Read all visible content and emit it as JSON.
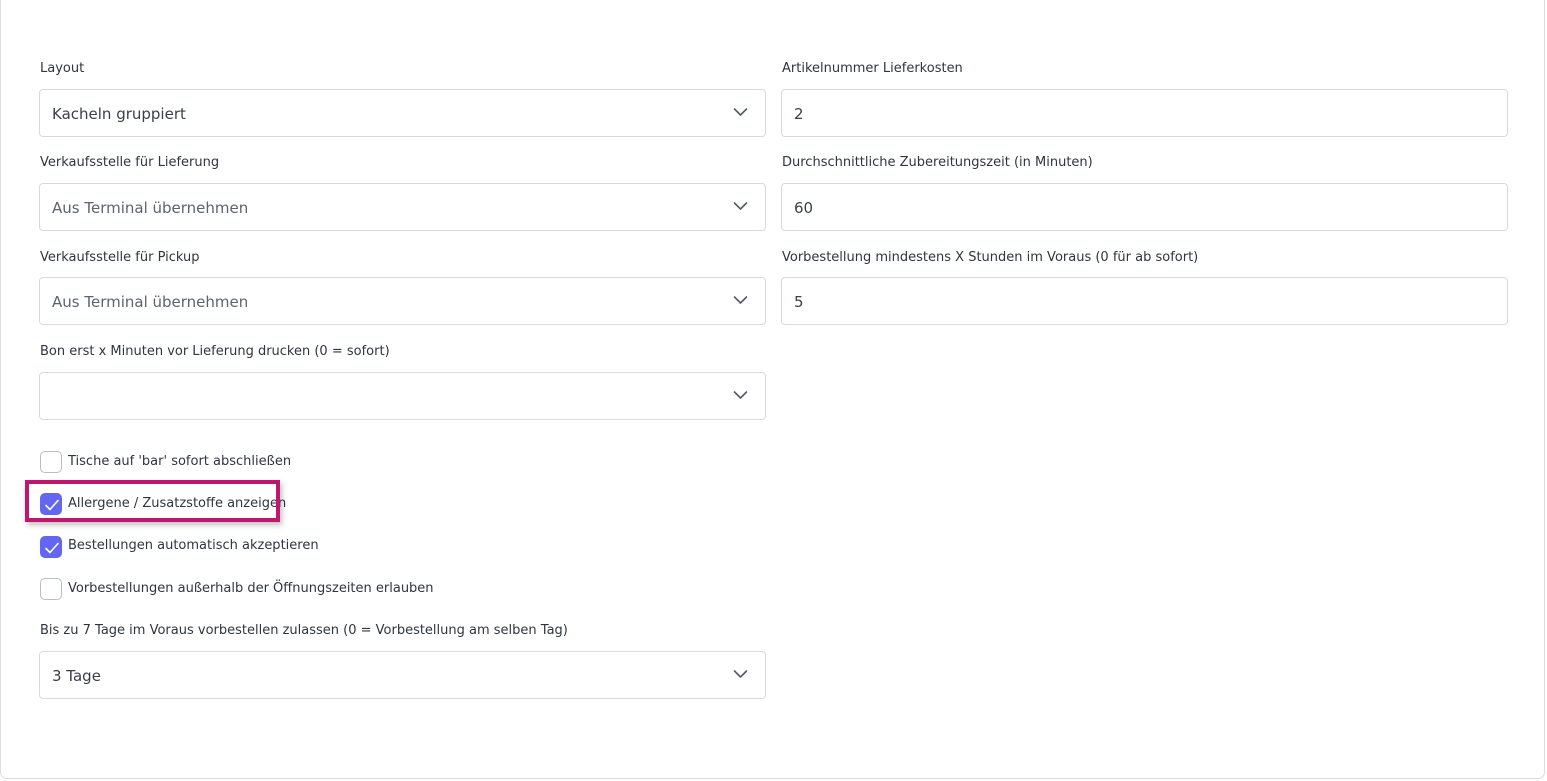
{
  "form": {
    "layout": {
      "label": "Layout",
      "value": "Kacheln gruppiert"
    },
    "article_delivery_cost": {
      "label": "Artikelnummer Lieferkosten",
      "value": "2"
    },
    "pos_delivery": {
      "label": "Verkaufsstelle für Lieferung",
      "value": "Aus Terminal übernehmen"
    },
    "avg_prep_time": {
      "label": "Durchschnittliche Zubereitungszeit (in Minuten)",
      "value": "60"
    },
    "pos_pickup": {
      "label": "Verkaufsstelle für Pickup",
      "value": "Aus Terminal übernehmen"
    },
    "preorder_hours": {
      "label": "Vorbestellung mindestens X Stunden im Voraus (0 für ab sofort)",
      "value": "5"
    },
    "print_receipt_minutes": {
      "label": "Bon erst x Minuten vor Lieferung drucken (0 = sofort)",
      "value": ""
    },
    "checkboxes": [
      {
        "label": "Tische auf 'bar' sofort abschließen",
        "checked": false
      },
      {
        "label": "Allergene / Zusatzstoffe anzeigen",
        "checked": true
      },
      {
        "label": "Bestellungen automatisch akzeptieren",
        "checked": true
      },
      {
        "label": "Vorbestellungen außerhalb der Öffnungszeiten erlauben",
        "checked": false
      }
    ],
    "preorder_days": {
      "label": "Bis zu 7 Tage im Voraus vorbestellen zulassen (0 = Vorbestellung am selben Tag)",
      "value": "3 Tage"
    }
  },
  "colors": {
    "accent": "#6366f1",
    "highlight": "#c0166f"
  },
  "icons": {
    "dropdown": "chevron-down-icon",
    "check": "checkmark-icon"
  }
}
